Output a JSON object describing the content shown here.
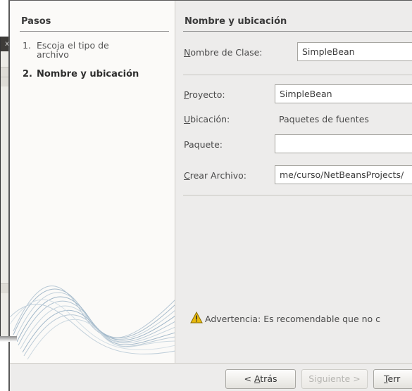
{
  "background_window": {
    "close_glyph": "x"
  },
  "steps": {
    "header": "Pasos",
    "items": [
      {
        "num": "1.",
        "line1": "Escoja el tipo de",
        "line2": "archivo"
      },
      {
        "num": "2.",
        "line1": "Nombre y ubicación"
      }
    ]
  },
  "content": {
    "header": "Nombre y ubicación",
    "class_name": {
      "label_pre": "",
      "label_u": "N",
      "label_post": "ombre de Clase:",
      "value": "SimpleBean"
    },
    "project": {
      "label_u": "P",
      "label_post": "royecto:",
      "value": "SimpleBean"
    },
    "location": {
      "label_u": "U",
      "label_post": "bicación:",
      "value": "Paquetes de fuentes"
    },
    "package": {
      "label": "Paquete:",
      "value": ""
    },
    "create_file": {
      "label_u": "C",
      "label_post": "rear Archivo:",
      "value": "me/curso/NetBeansProjects/"
    },
    "warning": "Advertencia: Es recomendable que no c"
  },
  "footer": {
    "back": {
      "pre": "< ",
      "u": "A",
      "post": "trás"
    },
    "next": "Siguiente >",
    "finish": {
      "u": "T",
      "post": "err"
    }
  },
  "colors": {
    "dialog_bg": "#edeceb",
    "steps_bg": "#fbfaf8",
    "warning_icon": "#e8b90c"
  },
  "icons": [
    "close-icon",
    "warning-icon",
    "wave-decoration"
  ]
}
